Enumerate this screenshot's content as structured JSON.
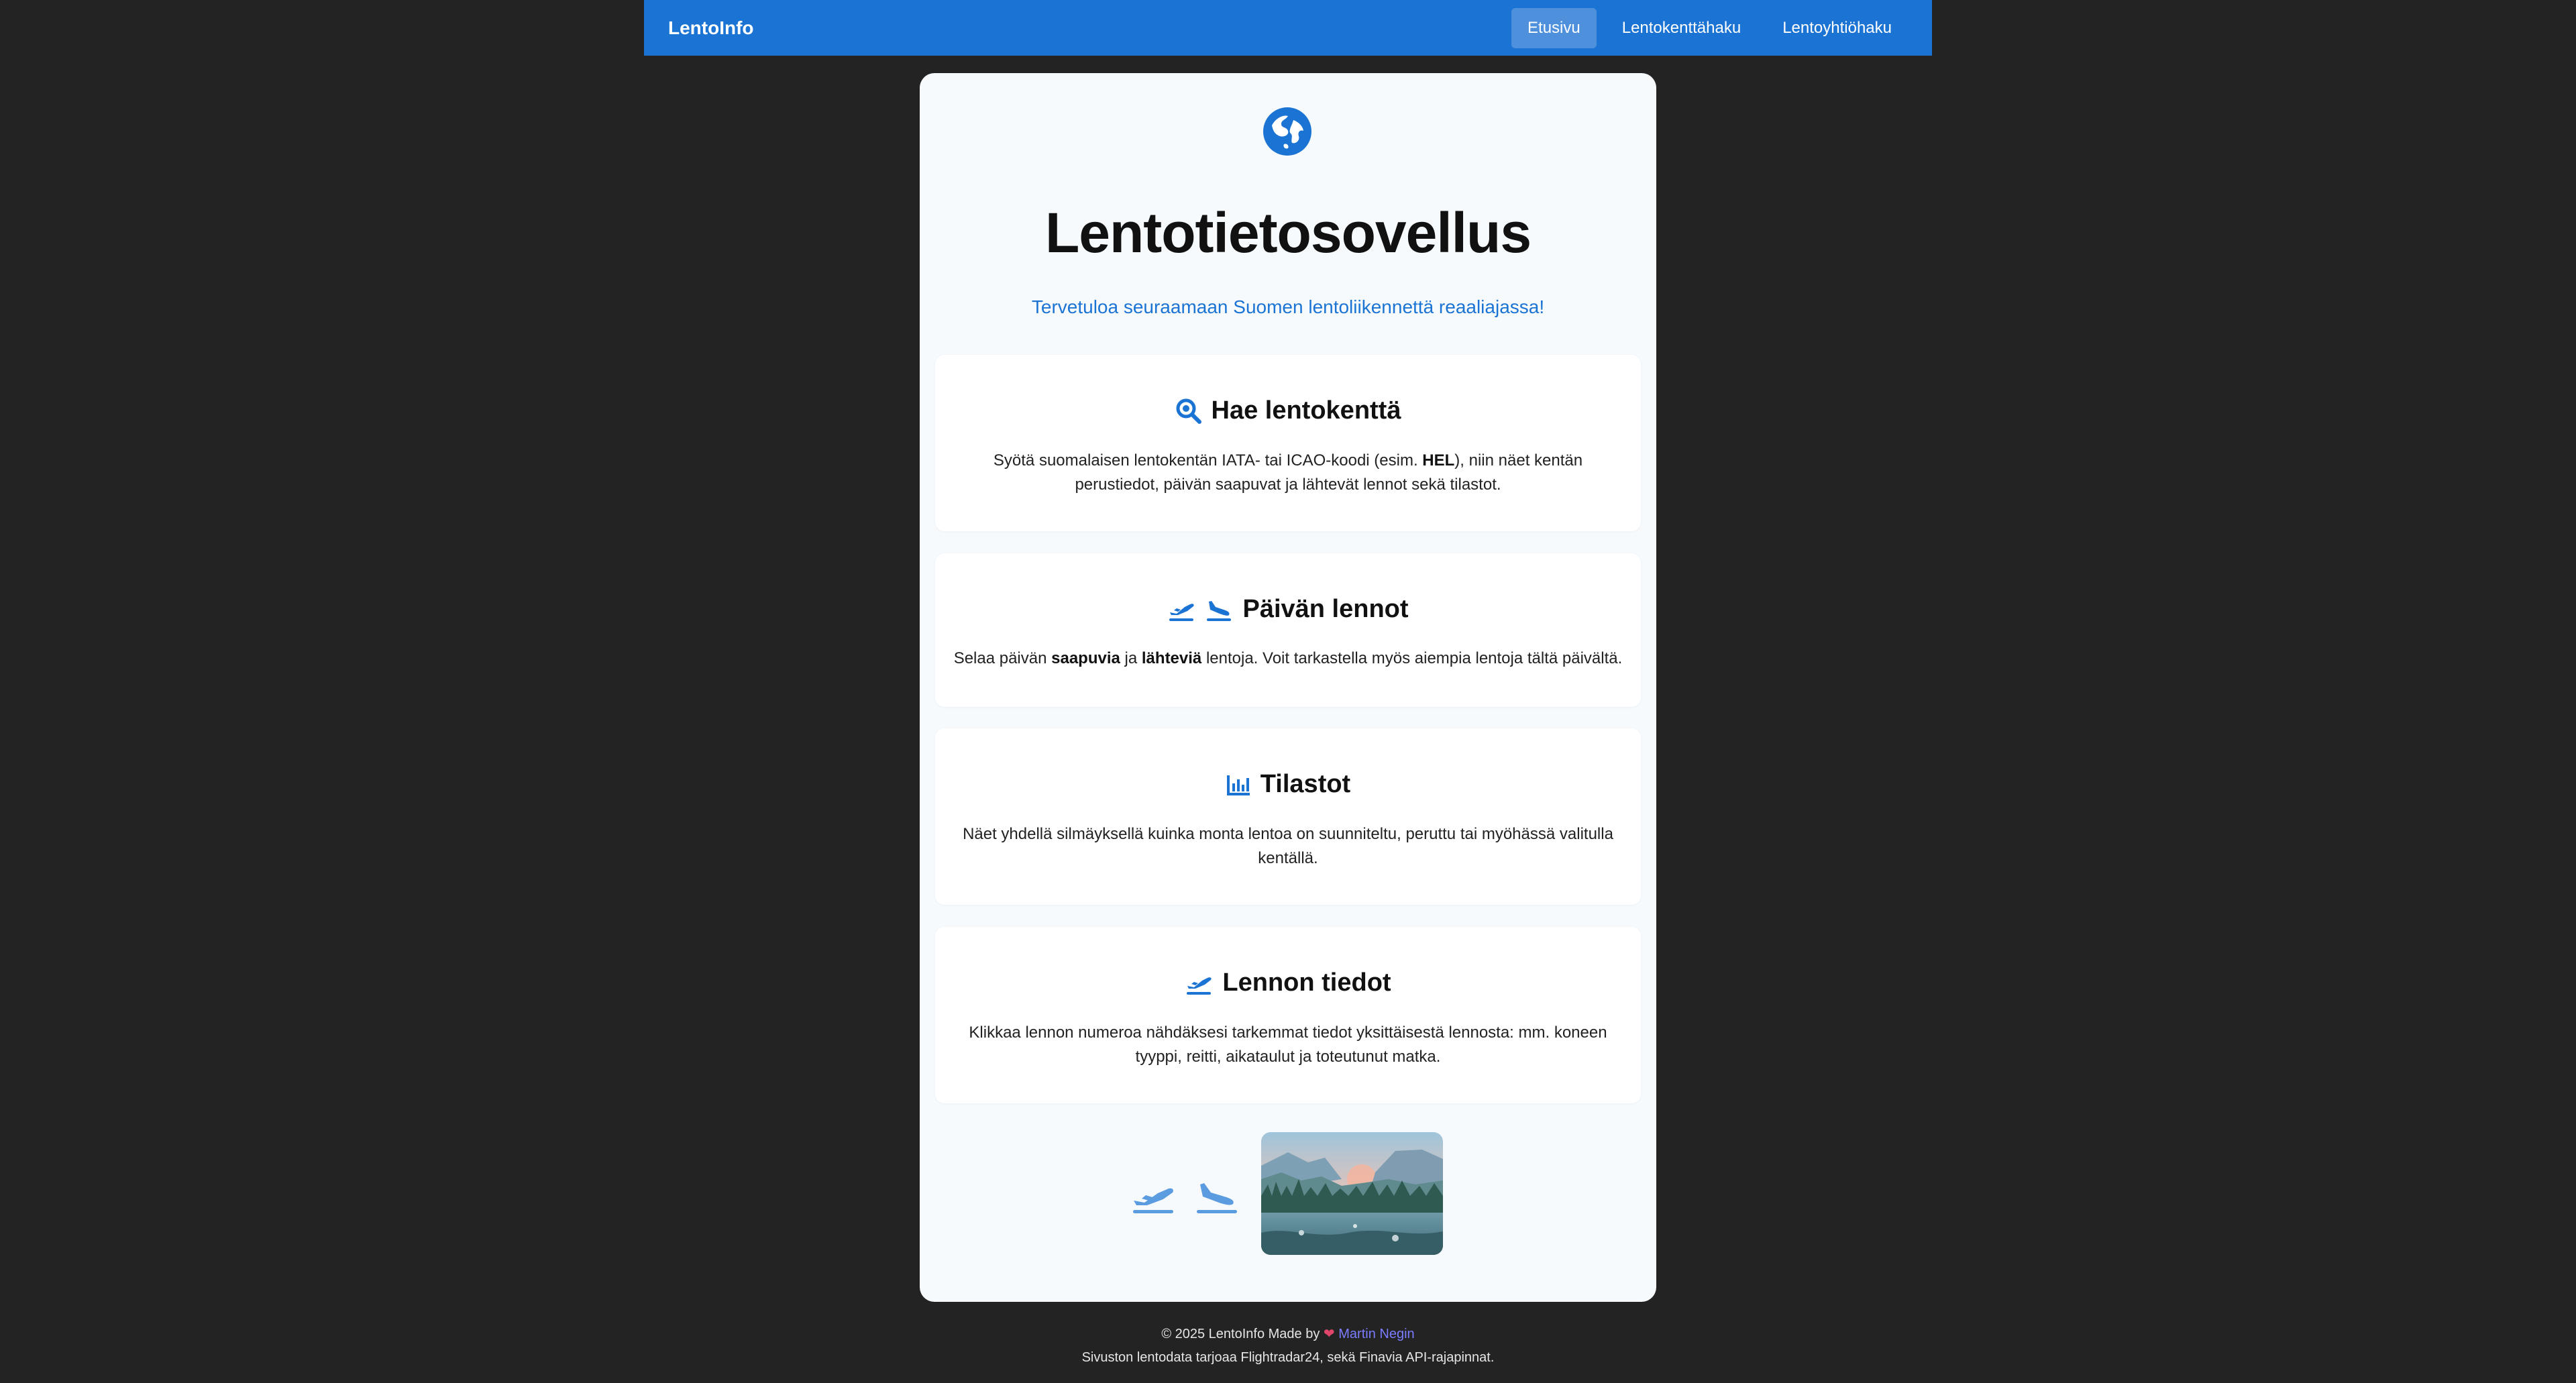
{
  "nav": {
    "brand": "LentoInfo",
    "links": [
      "Etusivu",
      "Lentokenttähaku",
      "Lentoyhtiöhaku"
    ],
    "active_index": 0
  },
  "hero": {
    "title": "Lentotietosovellus",
    "subtitle": "Tervetuloa seuraamaan Suomen lentoliikennettä reaaliajassa!"
  },
  "cards": [
    {
      "title": "Hae lentokenttä",
      "text_parts": [
        "Syötä suomalaisen lentokentän IATA- tai ICAO-koodi (esim. ",
        "HEL",
        "), niin näet kentän perustiedot, päivän saapuvat ja lähtevät lennot sekä tilastot."
      ]
    },
    {
      "title": "Päivän lennot",
      "text_parts": [
        "Selaa päivän ",
        "saapuvia",
        " ja ",
        "lähteviä",
        " lentoja. Voit tarkastella myös aiempia lentoja tältä päivältä."
      ]
    },
    {
      "title": "Tilastot",
      "text": "Näet yhdellä silmäyksellä kuinka monta lentoa on suunniteltu, peruttu tai myöhässä valitulla kentällä."
    },
    {
      "title": "Lennon tiedot",
      "text": "Klikkaa lennon numeroa nähdäksesi tarkemmat tiedot yksittäisestä lennosta: mm. koneen tyyppi, reitti, aikataulut ja toteutunut matka."
    }
  ],
  "footer": {
    "line1_prefix": "© 2025 LentoInfo Made by",
    "author": "Martin Negin",
    "line2": "Sivuston lentodata tarjoaa Flightradar24, sekä Finavia API-rajapinnat."
  },
  "icons": {
    "globe": "globe-icon",
    "search": "search-icon",
    "departure": "plane-departure-icon",
    "arrival": "plane-arrival-icon",
    "stats": "bar-chart-icon",
    "heart": "heart-icon"
  },
  "colors": {
    "accent": "#1b74d3",
    "background": "#232323",
    "panel": "#f6fafd",
    "heart": "#e0456a",
    "author_link": "#7b7cff"
  }
}
